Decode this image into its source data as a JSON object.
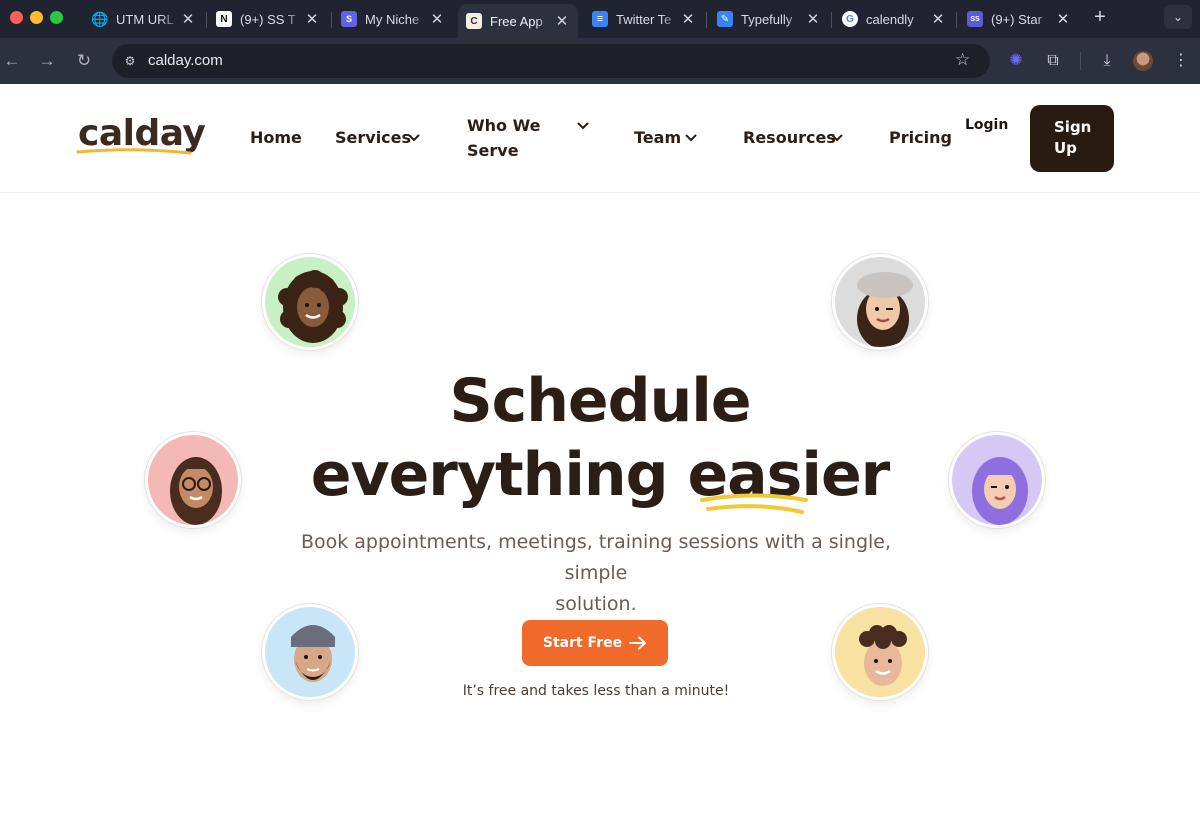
{
  "browser": {
    "tabs": [
      {
        "title": "UTM URL",
        "favicon": "globe-icon",
        "active": false
      },
      {
        "title": "(9+) SS T",
        "favicon": "notion-icon",
        "active": false
      },
      {
        "title": "My Niche",
        "favicon": "stripe-icon",
        "active": false
      },
      {
        "title": "Free App",
        "favicon": "calday-icon",
        "active": true
      },
      {
        "title": "Twitter Te",
        "favicon": "google-docs-icon",
        "active": false
      },
      {
        "title": "Typefully",
        "favicon": "typefully-icon",
        "active": false
      },
      {
        "title": "calendly",
        "favicon": "google-icon",
        "active": false
      },
      {
        "title": "(9+) Star",
        "favicon": "starter-story-icon",
        "active": false
      }
    ],
    "url": "calday.com"
  },
  "site": {
    "logo": "calday",
    "nav": {
      "home": "Home",
      "services": "Services",
      "who_we_serve_1": "Who We",
      "who_we_serve_2": "Serve",
      "team": "Team",
      "resources": "Resources",
      "pricing": "Pricing",
      "login": "Login",
      "signup_1": "Sign",
      "signup_2": "Up"
    }
  },
  "hero": {
    "headline_line1": "Schedule",
    "headline_line2_a": "everything ",
    "headline_line2_b": "easier",
    "subtitle_line1": "Book appointments, meetings, training sessions with a single, simple",
    "subtitle_line2": "solution.",
    "cta": "Start Free",
    "note": "It’s free and takes less than a minute!"
  },
  "colors": {
    "accent_orange": "#ef6a2b",
    "dark_brown": "#2a1b12",
    "underline_yellow": "#f2c934"
  }
}
